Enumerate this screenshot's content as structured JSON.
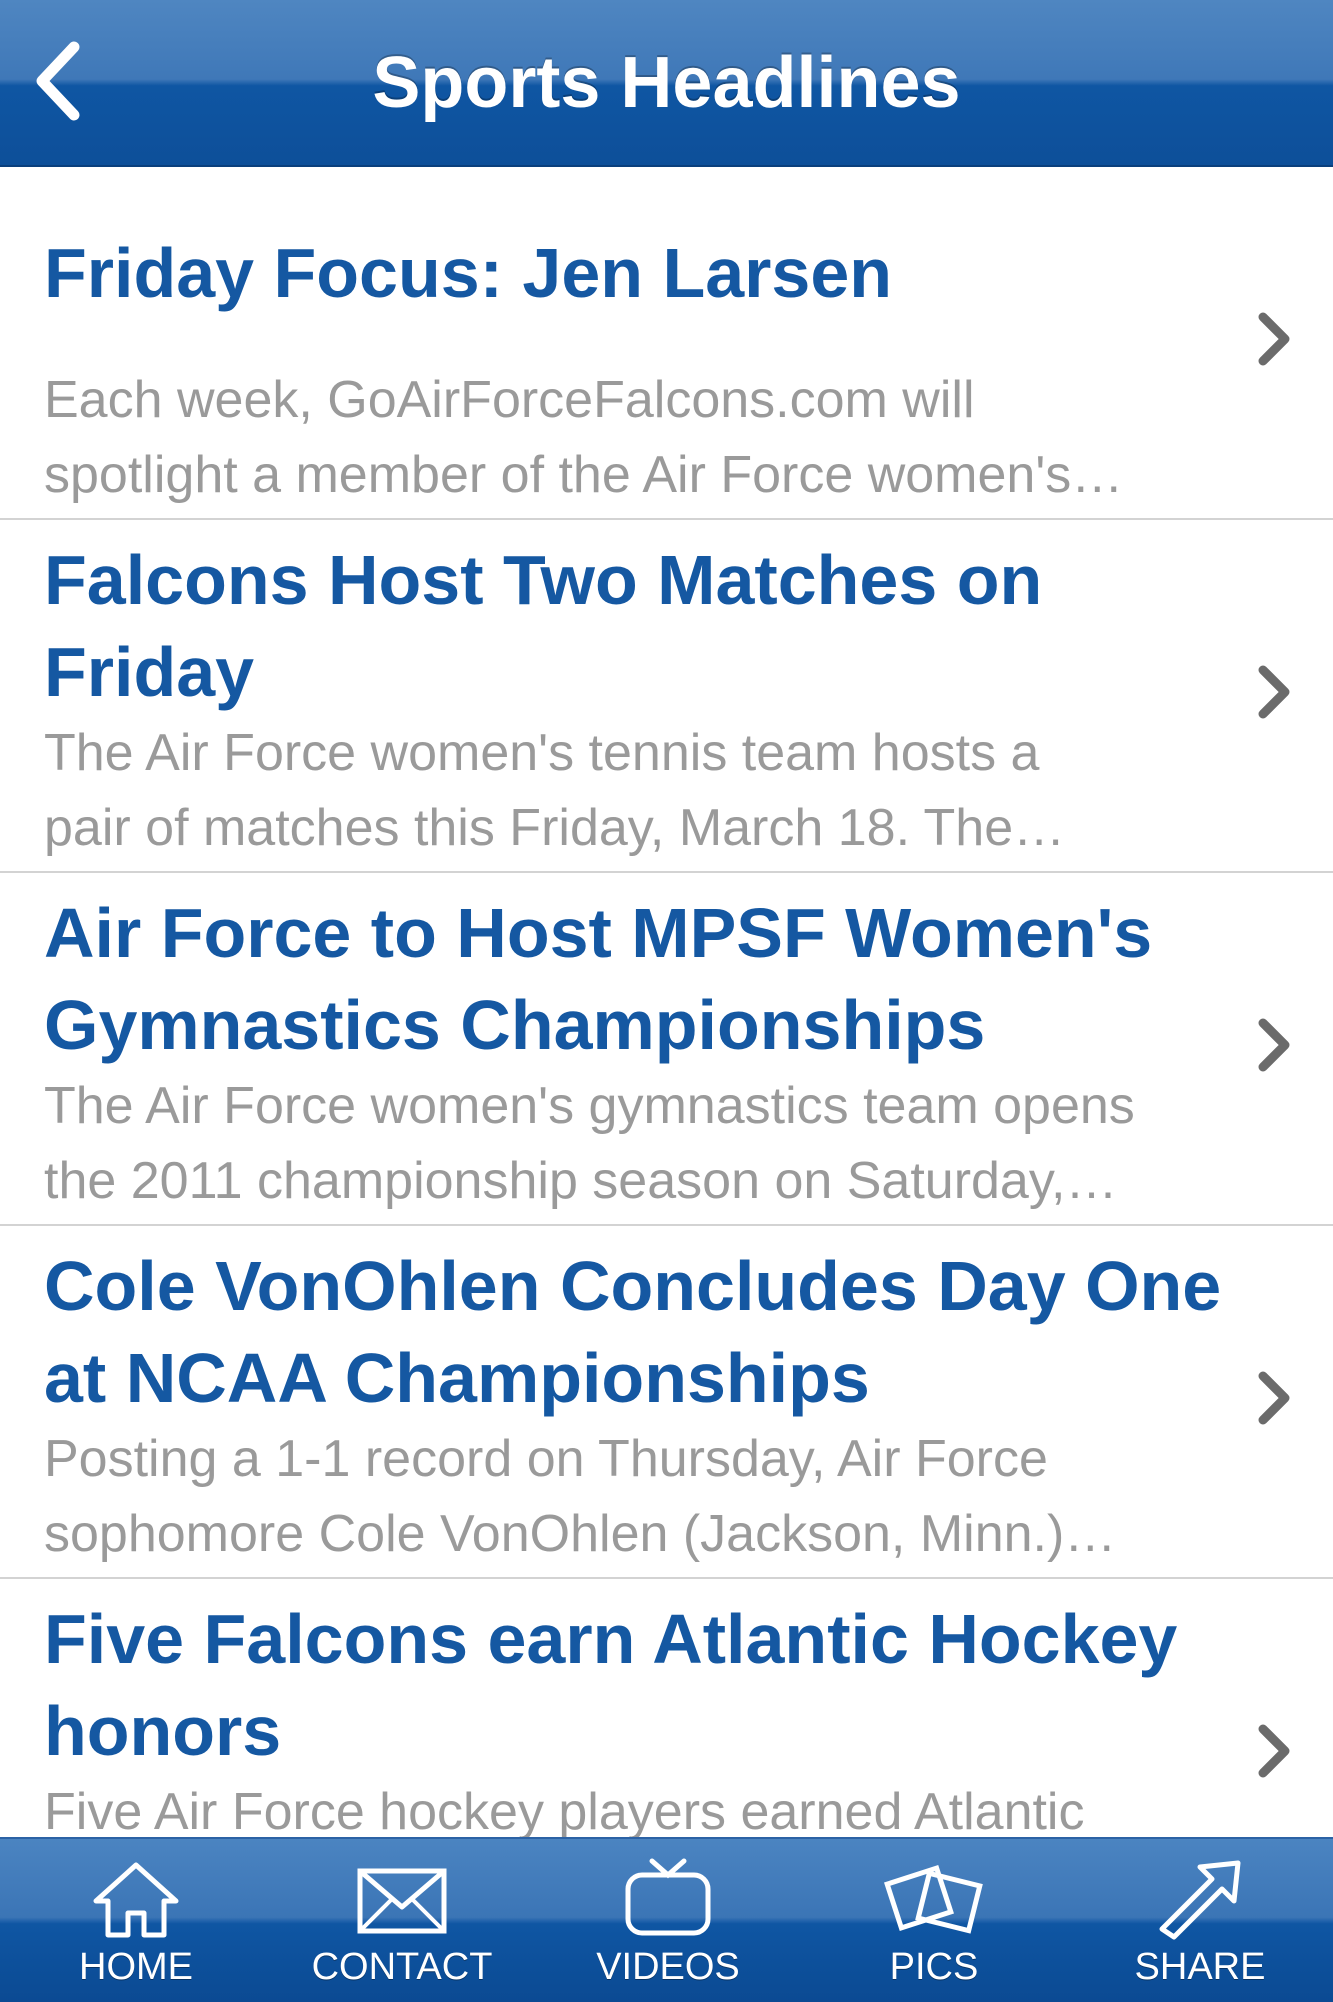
{
  "navbar": {
    "title": "Sports Headlines",
    "back_icon": "chevron-left-icon"
  },
  "headlines": [
    {
      "title_lines": [
        "Friday Focus: Jen Larsen"
      ],
      "summary_lines": [
        "Each week, GoAirForceFalcons.com will",
        "spotlight a member of the Air Force women's…"
      ]
    },
    {
      "title_lines": [
        "Falcons Host Two Matches on",
        "Friday"
      ],
      "summary_lines": [
        "The Air Force women's tennis team hosts a",
        "pair of matches this Friday, March 18. The…"
      ]
    },
    {
      "title_lines": [
        "Air Force to Host MPSF Women's",
        "Gymnastics Championships"
      ],
      "summary_lines": [
        "The Air Force women's gymnastics team opens",
        "the 2011 championship season on Saturday,…"
      ]
    },
    {
      "title_lines": [
        "Cole VonOhlen Concludes Day One",
        "at NCAA Championships"
      ],
      "summary_lines": [
        "Posting a 1-1 record on Thursday, Air Force",
        "sophomore Cole VonOhlen (Jackson, Minn.)…"
      ]
    },
    {
      "title_lines": [
        "Five Falcons earn Atlantic Hockey",
        "honors"
      ],
      "summary_lines": [
        "Five Air Force hockey players earned Atlantic"
      ]
    }
  ],
  "tabbar": {
    "tabs": [
      {
        "label": "HOME",
        "icon": "home-icon"
      },
      {
        "label": "CONTACT",
        "icon": "envelope-icon"
      },
      {
        "label": "VIDEOS",
        "icon": "tv-icon"
      },
      {
        "label": "PICS",
        "icon": "photos-icon"
      },
      {
        "label": "SHARE",
        "icon": "share-arrow-icon"
      }
    ]
  },
  "colors": {
    "nav_blue": "#0f56a3",
    "title_blue": "#1558a2",
    "summary_gray": "#9a9a9a"
  }
}
